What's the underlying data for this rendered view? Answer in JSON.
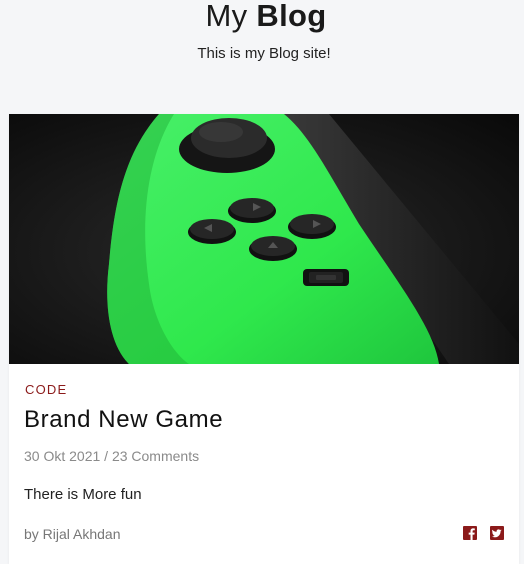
{
  "header": {
    "title_regular": "My",
    "title_bold": "Blog",
    "tagline": "This is my Blog site!"
  },
  "post": {
    "category": "CODE",
    "title": "Brand New Game",
    "date": "30 Okt 2021",
    "comments": "23 Comments",
    "meta_separator": " / ",
    "excerpt": "There is More fun",
    "author": "by Rijal Akhdan",
    "image_alt": "Green game controller close-up",
    "share_icons": [
      "facebook-icon",
      "twitter-icon"
    ]
  },
  "colors": {
    "accent": "#8b1a1a",
    "share_icon": "#8b1a1a",
    "controller_green": "#2fe84c",
    "page_background": "#f5f6f8"
  }
}
